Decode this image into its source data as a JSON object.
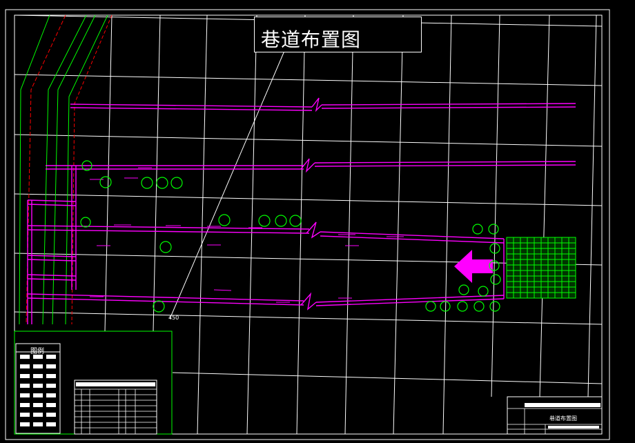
{
  "drawing": {
    "title": "巷道布置图",
    "coordinate_label": "450",
    "legend_title": "图例",
    "title_block_name": "巷道布置图"
  },
  "colors": {
    "background": "#000000",
    "frame": "#ffffff",
    "grid": "#ffffff",
    "roadway": "#ff00ff",
    "boundary_green": "#00ff00",
    "boundary_red": "#ff0000",
    "arrow": "#ff00ff",
    "hatch": "#00ff00"
  }
}
